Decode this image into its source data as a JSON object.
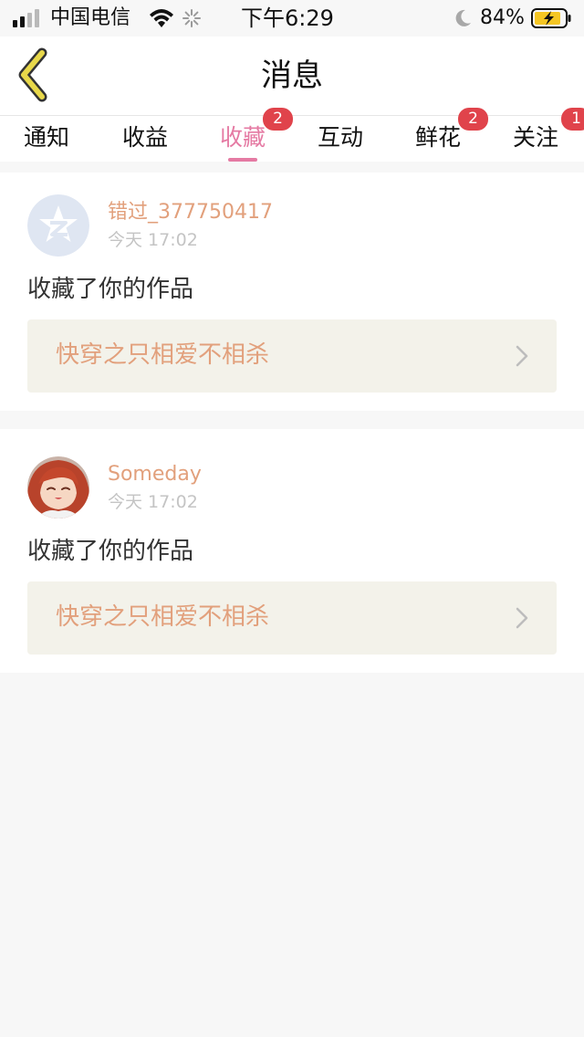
{
  "status_bar": {
    "carrier": "中国电信",
    "time": "下午6:29",
    "battery": "84%"
  },
  "header": {
    "title": "消息",
    "back_icon": "back-chevron-icon"
  },
  "tabs": [
    {
      "label": "通知",
      "badge": ""
    },
    {
      "label": "收益",
      "badge": ""
    },
    {
      "label": "收藏",
      "badge": "2",
      "active": true
    },
    {
      "label": "互动",
      "badge": ""
    },
    {
      "label": "鲜花",
      "badge": "2"
    },
    {
      "label": "关注",
      "badge": "1"
    }
  ],
  "messages": [
    {
      "username": "错过_377750417",
      "time": "今天 17:02",
      "action": "收藏了你的作品",
      "work_title": "快穿之只相爱不相杀",
      "avatar": "default-qq-avatar-icon"
    },
    {
      "username": "Someday",
      "time": "今天 17:02",
      "action": "收藏了你的作品",
      "work_title": "快穿之只相爱不相杀",
      "avatar": "anime-girl-avatar"
    }
  ],
  "colors": {
    "accent": "#e57aa3",
    "badge": "#e0434b",
    "username": "#e2a07c",
    "work_bg": "#f3f2ea",
    "back_icon": "#e8d84a"
  }
}
